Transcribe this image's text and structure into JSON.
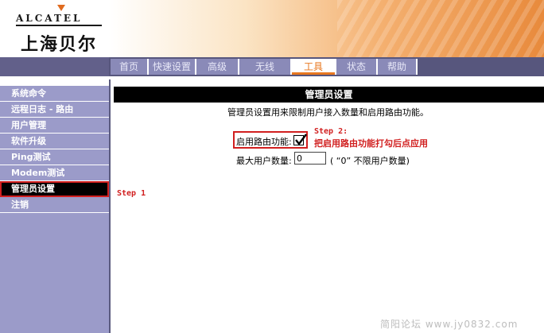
{
  "header": {
    "brand": "ALCATEL",
    "brand_cn": "上海贝尔"
  },
  "nav": {
    "tabs": [
      {
        "label": "首页",
        "width": 48
      },
      {
        "label": "快速设置",
        "width": 60
      },
      {
        "label": "高级",
        "width": 54
      },
      {
        "label": "无线",
        "width": 66
      },
      {
        "label": "工具",
        "width": 56,
        "active": true
      },
      {
        "label": "状态",
        "width": 52
      },
      {
        "label": "帮助",
        "width": 50
      }
    ]
  },
  "sidebar": {
    "items": [
      {
        "label": "系统命令"
      },
      {
        "label": "远程日志 - 路由"
      },
      {
        "label": "用户管理"
      },
      {
        "label": "软件升级"
      },
      {
        "label": "Ping测试"
      },
      {
        "label": "Modem测试"
      },
      {
        "label": "管理员设置",
        "active": true
      },
      {
        "label": "注销"
      }
    ]
  },
  "main": {
    "title": "管理员设置",
    "description": "管理员设置用来限制用户接入数量和启用路由功能。",
    "enable_routing_label": "启用路由功能:",
    "enable_routing_checked": true,
    "max_users_label": "最大用户数量:",
    "max_users_value": "0",
    "max_users_hint": "( “0” 不限用户数量)"
  },
  "annotations": {
    "step2_title": "Step 2:",
    "step2_text": "把启用路由功能打勾后点应用",
    "step1": "Step 1"
  },
  "watermark": "简阳论坛 www.jy0832.com",
  "colors": {
    "nav_bg": "#57567d",
    "tab_bg": "#8a8ab8",
    "tab_active_text": "#e8771f",
    "sidebar_bg": "#9b9bc9",
    "highlight_red": "#d11f1f"
  }
}
